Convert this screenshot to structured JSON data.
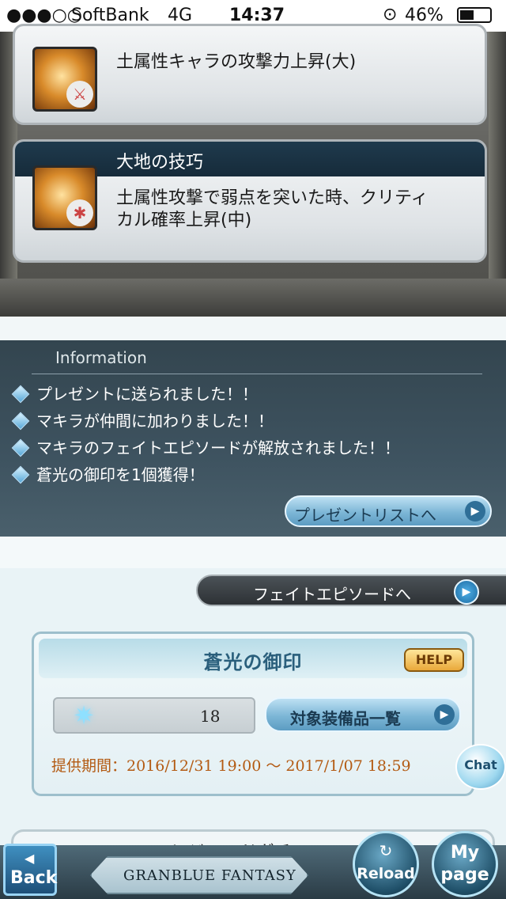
{
  "status_bar": {
    "signal": "●●●○○",
    "carrier": "SoftBank",
    "network": "4G",
    "time": "14:37",
    "lock_icon": "rotation-lock-icon",
    "battery_percent": "46%",
    "battery_level": 0.46
  },
  "skills": [
    {
      "name": "",
      "icon": "earth-sword-icon",
      "description": "土属性キャラの攻撃力上昇(大)"
    },
    {
      "name": "大地の技巧",
      "icon": "earth-critical-icon",
      "description_lines": [
        "土属性攻撃で弱点を突いた時、クリティ",
        "カル確率上昇(中)"
      ]
    }
  ],
  "information": {
    "title": "Information",
    "items": [
      "プレゼントに送られました！！",
      "マキラが仲間に加わりました！！",
      "マキラのフェイトエピソードが解放されました！！",
      "蒼光の御印を1個獲得！"
    ],
    "present_button": "プレゼントリストへ"
  },
  "fate_episode_button": "フェイトエピソードへ",
  "seal": {
    "title": "蒼光の御印",
    "help_label": "HELP",
    "count": "18",
    "equipment_button": "対象装備品一覧",
    "period": "提供期間：2016/12/31 19:00 〜 2017/1/07 18:59"
  },
  "chat_label": "Chat",
  "legend_gacha_label": "レジェンドガチャ",
  "footer": {
    "back_label": "Back",
    "logo_text": "GRANBLUE FANTASY",
    "reload_label": "Reload",
    "mypage_line1": "My",
    "mypage_line2": "page"
  }
}
